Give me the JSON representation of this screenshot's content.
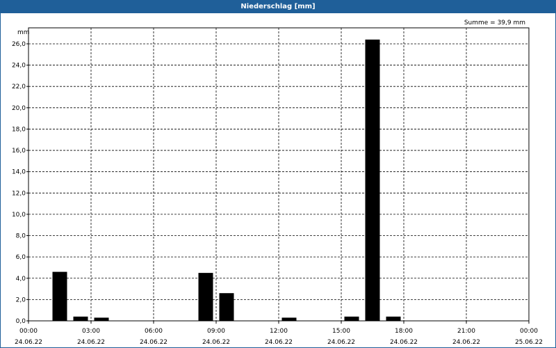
{
  "window": {
    "title": "Niederschlag [mm]",
    "summary": "Summe = 39,9 mm"
  },
  "chart_data": {
    "type": "bar",
    "unit": "mm",
    "ylabel": "mm",
    "ylim": [
      0,
      27.5
    ],
    "y_ticks": [
      "0,0",
      "2,0",
      "4,0",
      "6,0",
      "8,0",
      "10,0",
      "12,0",
      "14,0",
      "16,0",
      "18,0",
      "20,0",
      "22,0",
      "24,0",
      "26,0"
    ],
    "x_range": [
      "2022-06-24T00:00",
      "2022-06-25T00:00"
    ],
    "x_ticks": [
      {
        "time": "00:00",
        "date": "24.06.22"
      },
      {
        "time": "03:00",
        "date": "24.06.22"
      },
      {
        "time": "06:00",
        "date": "24.06.22"
      },
      {
        "time": "09:00",
        "date": "24.06.22"
      },
      {
        "time": "12:00",
        "date": "24.06.22"
      },
      {
        "time": "15:00",
        "date": "24.06.22"
      },
      {
        "time": "18:00",
        "date": "24.06.22"
      },
      {
        "time": "21:00",
        "date": "24.06.22"
      },
      {
        "time": "00:00",
        "date": "25.06.22"
      }
    ],
    "bars": [
      {
        "time": "01:00",
        "value": 4.6
      },
      {
        "time": "02:00",
        "value": 0.4
      },
      {
        "time": "03:00",
        "value": 0.3
      },
      {
        "time": "08:00",
        "value": 4.5
      },
      {
        "time": "09:00",
        "value": 2.6
      },
      {
        "time": "12:00",
        "value": 0.3
      },
      {
        "time": "15:00",
        "value": 0.4
      },
      {
        "time": "16:00",
        "value": 26.4
      },
      {
        "time": "17:00",
        "value": 0.4
      }
    ],
    "bar_color": "#000000",
    "grid": true
  }
}
